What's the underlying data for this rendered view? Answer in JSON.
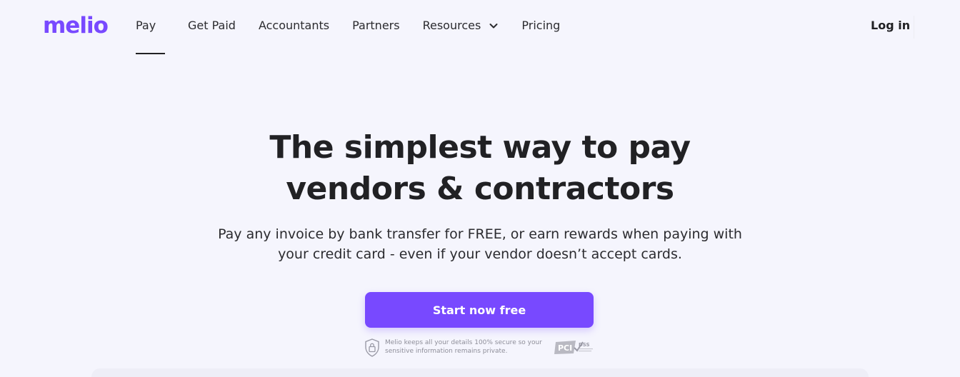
{
  "brand": {
    "logo_text": "melio",
    "accent": "#7849ff"
  },
  "nav": {
    "items": [
      {
        "label": "Pay",
        "active": true
      },
      {
        "label": "Get Paid"
      },
      {
        "label": "Accountants"
      },
      {
        "label": "Partners"
      },
      {
        "label": "Resources",
        "has_dropdown": true,
        "icon": "chevron-down-icon"
      },
      {
        "label": "Pricing"
      }
    ],
    "login_label": "Log in"
  },
  "hero": {
    "title_line1": "The simplest way to pay",
    "title_line2": "vendors & contractors",
    "subtitle_line1": "Pay any invoice by bank transfer for FREE, or earn rewards when paying with",
    "subtitle_line2": "your credit card - even if your vendor doesn’t accept cards.",
    "cta_label": "Start now free"
  },
  "security": {
    "text_line1": "Melio keeps all your details 100% secure so your",
    "text_line2": "sensitive information remains private.",
    "lock_icon": "lock-shield-icon",
    "badge_icon": "pci-dss-icon",
    "badge_text": "PCI",
    "badge_text_small": "DSS"
  }
}
